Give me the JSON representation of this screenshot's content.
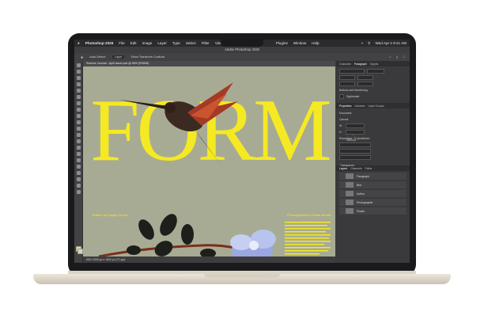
{
  "menubar": {
    "app_name": "Photoshop 2026",
    "items": [
      "File",
      "Edit",
      "Image",
      "Layer",
      "Type",
      "Select",
      "Filter",
      "View"
    ],
    "right_items": [
      "Plugins",
      "Window",
      "Help"
    ],
    "clock": "Wed Apr 2  9:41 AM"
  },
  "window": {
    "title": "Adobe Photoshop 2026"
  },
  "options_bar": {
    "auto_select": "Auto-Select:",
    "layer_value": "Layer",
    "show_transform": "Show Transform Controls"
  },
  "document": {
    "tab": "Science Journal - April Issue.psd @ 66% (RGB/8)",
    "status": "66%   2000 px x 1600 px (72 ppi)"
  },
  "poster": {
    "headline": "FORM",
    "byline_left": "Written by Sanjay Kumar",
    "byline_right": "Photographed by Vivian Brooks",
    "accent_color": "#f5e923",
    "background_color": "#a8ab94"
  },
  "right_panel": {
    "tabs_top": [
      "Character",
      "Paragraph",
      "Glyphs"
    ],
    "section_buttons": "Buttons and Numbering",
    "hyphenate": "Hyphenate",
    "tabs_mid": [
      "Properties",
      "Libraries",
      "Layer Comps"
    ],
    "doc_label": "Document",
    "canvas_label": "Canvas",
    "width": "2000 px",
    "height": "1600 px",
    "resolution": "Resolution: 72 pixels/inch",
    "mode": "RGB Color",
    "bits": "8 Bits/Channel",
    "fill": "Transparent",
    "tabs_layers": [
      "Layers",
      "Channels",
      "Paths"
    ],
    "layers": [
      "Paragraph",
      "Bird",
      "Author",
      "Photographer",
      "Flower"
    ]
  }
}
